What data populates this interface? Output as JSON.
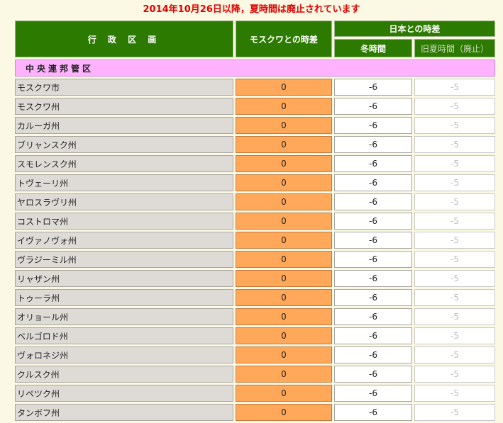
{
  "notice": "2014年10月26日以降，夏時間は廃止されています",
  "table": {
    "header": {
      "region": "行 政 区 画",
      "moscow_diff": "モスクワとの時差",
      "japan_diff": "日本との時差",
      "winter": "冬時間",
      "summer_old": "旧夏時間（廃止）"
    },
    "section": "中央連邦管区",
    "rows": [
      {
        "name": "モスクワ市",
        "moscow": "0",
        "winter": "-6",
        "summer": "-5"
      },
      {
        "name": "モスクワ州",
        "moscow": "0",
        "winter": "-6",
        "summer": "-5"
      },
      {
        "name": "カルーガ州",
        "moscow": "0",
        "winter": "-6",
        "summer": "-5"
      },
      {
        "name": "ブリャンスク州",
        "moscow": "0",
        "winter": "-6",
        "summer": "-5"
      },
      {
        "name": "スモレンスク州",
        "moscow": "0",
        "winter": "-6",
        "summer": "-5"
      },
      {
        "name": "トヴェーリ州",
        "moscow": "0",
        "winter": "-6",
        "summer": "-5"
      },
      {
        "name": "ヤロスラヴリ州",
        "moscow": "0",
        "winter": "-6",
        "summer": "-5"
      },
      {
        "name": "コストロマ州",
        "moscow": "0",
        "winter": "-6",
        "summer": "-5"
      },
      {
        "name": "イヴァノヴォ州",
        "moscow": "0",
        "winter": "-6",
        "summer": "-5"
      },
      {
        "name": "ヴラジーミル州",
        "moscow": "0",
        "winter": "-6",
        "summer": "-5"
      },
      {
        "name": "リャザン州",
        "moscow": "0",
        "winter": "-6",
        "summer": "-5"
      },
      {
        "name": "トゥーラ州",
        "moscow": "0",
        "winter": "-6",
        "summer": "-5"
      },
      {
        "name": "オリョール州",
        "moscow": "0",
        "winter": "-6",
        "summer": "-5"
      },
      {
        "name": "ベルゴロド州",
        "moscow": "0",
        "winter": "-6",
        "summer": "-5"
      },
      {
        "name": "ヴォロネジ州",
        "moscow": "0",
        "winter": "-6",
        "summer": "-5"
      },
      {
        "name": "クルスク州",
        "moscow": "0",
        "winter": "-6",
        "summer": "-5"
      },
      {
        "name": "リペツク州",
        "moscow": "0",
        "winter": "-6",
        "summer": "-5"
      },
      {
        "name": "タンボフ州",
        "moscow": "0",
        "winter": "-6",
        "summer": "-5"
      }
    ]
  },
  "colors": {
    "header_green": "#2d7a00",
    "section_pink": "#ffb2ff",
    "moscow_orange": "#ffa85a",
    "notice_red": "#e00000"
  }
}
